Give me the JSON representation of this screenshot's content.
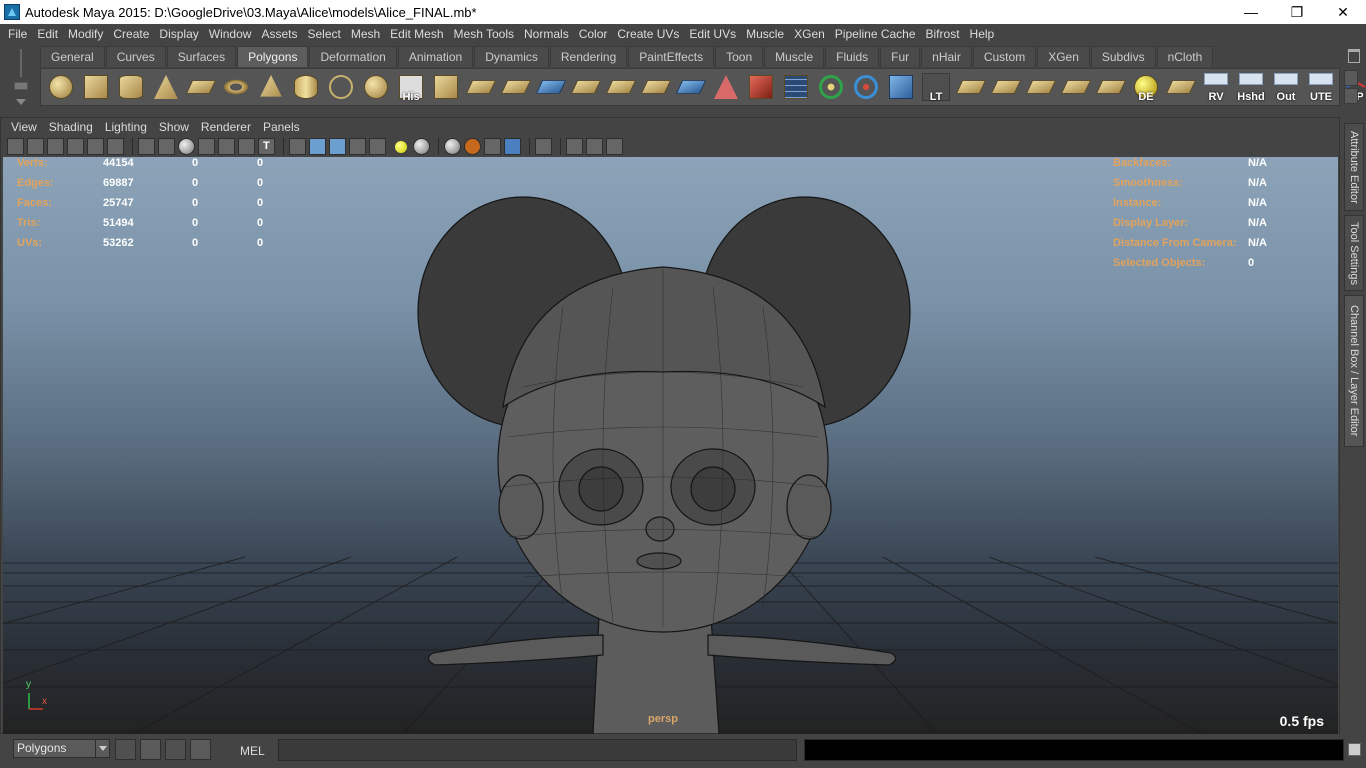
{
  "window": {
    "title": "Autodesk Maya 2015: D:\\GoogleDrive\\03.Maya\\Alice\\models\\Alice_FINAL.mb*",
    "controls": [
      "—",
      "❐",
      "✕"
    ]
  },
  "menubar": [
    "File",
    "Edit",
    "Modify",
    "Create",
    "Display",
    "Window",
    "Assets",
    "Select",
    "Mesh",
    "Edit Mesh",
    "Mesh Tools",
    "Normals",
    "Color",
    "Create UVs",
    "Edit UVs",
    "Muscle",
    "XGen",
    "Pipeline Cache",
    "Bifrost",
    "Help"
  ],
  "shelf": {
    "tabs": [
      "General",
      "Curves",
      "Surfaces",
      "Polygons",
      "Deformation",
      "Animation",
      "Dynamics",
      "Rendering",
      "PaintEffects",
      "Toon",
      "Muscle",
      "Fluids",
      "Fur",
      "nHair",
      "Custom",
      "XGen",
      "Subdivs",
      "nCloth"
    ],
    "active_tab": "Polygons",
    "icon_labels": {
      "his": "His",
      "lt": "LT",
      "de": "DE",
      "rv": "RV",
      "hshd": "Hshd",
      "out": "Out",
      "ute": "UTE",
      "cp": "CP"
    }
  },
  "panel": {
    "menu": [
      "View",
      "Shading",
      "Lighting",
      "Show",
      "Renderer",
      "Panels"
    ]
  },
  "hud": {
    "left": [
      {
        "label": "Verts:",
        "v1": "44154",
        "v2": "0",
        "v3": "0"
      },
      {
        "label": "Edges:",
        "v1": "69887",
        "v2": "0",
        "v3": "0"
      },
      {
        "label": "Faces:",
        "v1": "25747",
        "v2": "0",
        "v3": "0"
      },
      {
        "label": "Tris:",
        "v1": "51494",
        "v2": "0",
        "v3": "0"
      },
      {
        "label": "UVs:",
        "v1": "53262",
        "v2": "0",
        "v3": "0"
      }
    ],
    "right": [
      {
        "label": "Backfaces:",
        "value": "N/A"
      },
      {
        "label": "Smoothness:",
        "value": "N/A"
      },
      {
        "label": "Instance:",
        "value": "N/A"
      },
      {
        "label": "Display Layer:",
        "value": "N/A"
      },
      {
        "label": "Distance From Camera:",
        "value": "N/A"
      },
      {
        "label": "Selected Objects:",
        "value": "0"
      }
    ],
    "camera": "persp",
    "fps": "0.5 fps",
    "axis_y": "y",
    "axis_x": "x"
  },
  "side_tabs": [
    "Attribute Editor",
    "Tool Settings",
    "Channel Box / Layer Editor"
  ],
  "bottom": {
    "mode": "Polygons",
    "mel_label": "MEL",
    "command_value": ""
  },
  "colors": {
    "hud_label": "#e2a35c",
    "hud_value": "#ffffff",
    "active_tab": "#5d5d5d",
    "viewport_top": "#8ca3b8"
  }
}
